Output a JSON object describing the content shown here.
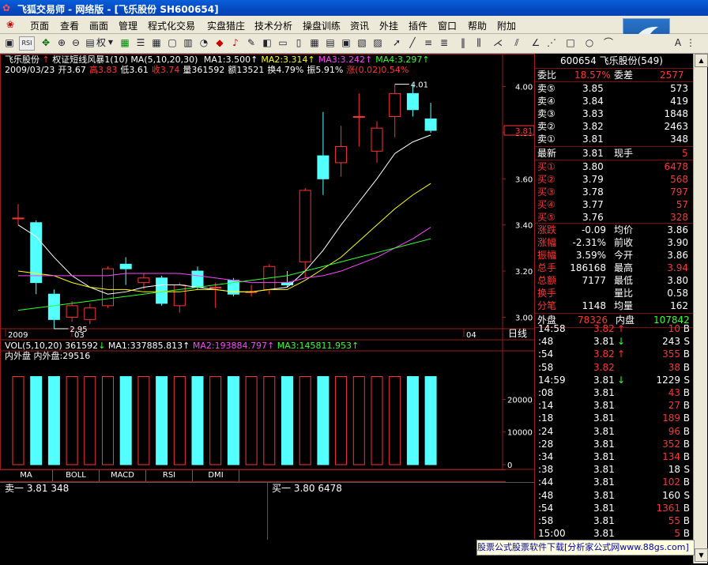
{
  "window": {
    "title": "飞狐交易师 - 网络版 - [飞乐股份 SH600654]"
  },
  "menu": [
    "页面",
    "查看",
    "画面",
    "管理",
    "程式化交易",
    "实盘猎庄",
    "技术分析",
    "操盘训练",
    "资讯",
    "外挂",
    "插件",
    "窗口",
    "帮助",
    "附加"
  ],
  "chart": {
    "stock_name": "飞乐股份",
    "indicator": "权证短线风暴1(10)",
    "ma_params": "MA(5,10,20,30)",
    "ma_items": [
      {
        "label": "MA1:3.500",
        "color": "#ffffff"
      },
      {
        "label": "MA2:3.314",
        "color": "#ffff00"
      },
      {
        "label": "MA3:3.242",
        "color": "#ff44ff"
      },
      {
        "label": "MA4:3.297",
        "color": "#33ff33"
      }
    ],
    "info": [
      {
        "label": "2009/03/23",
        "color": "#ffffff"
      },
      {
        "label": "开3.67",
        "color": "#ffffff"
      },
      {
        "label": "高3.83",
        "color": "#ff3333"
      },
      {
        "label": "低3.61",
        "color": "#ffffff"
      },
      {
        "label": "收3.74",
        "color": "#ff3333"
      },
      {
        "label": "量361592",
        "color": "#ffffff"
      },
      {
        "label": "额13521",
        "color": "#ffffff"
      },
      {
        "label": "换4.79%",
        "color": "#ffffff"
      },
      {
        "label": "振5.91%",
        "color": "#ffffff"
      },
      {
        "label": "涨(0.02)0.54%",
        "color": "#ff3333"
      }
    ],
    "high_label": "4.01",
    "low_label": "2.95",
    "price_axis": [
      "4.00",
      "3.80",
      "3.60",
      "3.40",
      "3.20",
      "3.00"
    ],
    "current_price_tag": "3.81",
    "date_axis": [
      "2009",
      "03",
      "04"
    ],
    "period_label": "日线",
    "vol_header": {
      "text": "VOL(5,10,20) 361592",
      "ma1": "MA1:337885.813",
      "ma2": "MA2:193884.797",
      "ma3": "MA3:145811.953"
    },
    "vol_sub": "内外盘 内外盘:29516",
    "vol_axis": [
      "20000",
      "10000",
      "0"
    ],
    "candles": [
      {
        "o": 3.43,
        "c": 3.43,
        "h": 3.49,
        "l": 3.4
      },
      {
        "o": 3.41,
        "c": 3.15,
        "h": 3.42,
        "l": 3.1
      },
      {
        "o": 3.1,
        "c": 2.99,
        "h": 3.12,
        "l": 2.95
      },
      {
        "o": 3.0,
        "c": 3.05,
        "h": 3.07,
        "l": 2.98
      },
      {
        "o": 2.99,
        "c": 3.04,
        "h": 3.06,
        "l": 2.97
      },
      {
        "o": 3.05,
        "c": 3.21,
        "h": 3.22,
        "l": 3.04
      },
      {
        "o": 3.23,
        "c": 3.21,
        "h": 3.26,
        "l": 3.14
      },
      {
        "o": 3.15,
        "c": 3.17,
        "h": 3.19,
        "l": 3.12
      },
      {
        "o": 3.17,
        "c": 3.06,
        "h": 3.18,
        "l": 3.05
      },
      {
        "o": 3.05,
        "c": 3.14,
        "h": 3.15,
        "l": 3.02
      },
      {
        "o": 3.2,
        "c": 3.13,
        "h": 3.22,
        "l": 3.12
      },
      {
        "o": 3.13,
        "c": 3.13,
        "h": 3.15,
        "l": 3.04
      },
      {
        "o": 3.16,
        "c": 3.1,
        "h": 3.17,
        "l": 3.09
      },
      {
        "o": 3.11,
        "c": 3.11,
        "h": 3.14,
        "l": 3.09
      },
      {
        "o": 3.12,
        "c": 3.22,
        "h": 3.23,
        "l": 3.1
      },
      {
        "o": 3.15,
        "c": 3.14,
        "h": 3.2,
        "l": 3.13
      },
      {
        "o": 3.24,
        "c": 3.55,
        "h": 3.56,
        "l": 3.17
      },
      {
        "o": 3.7,
        "c": 3.6,
        "h": 3.89,
        "l": 3.53
      },
      {
        "o": 3.67,
        "c": 3.74,
        "h": 3.83,
        "l": 3.61
      },
      {
        "o": 3.87,
        "c": 3.87,
        "h": 3.97,
        "l": 3.74
      },
      {
        "o": 3.72,
        "c": 3.82,
        "h": 3.85,
        "l": 3.67
      },
      {
        "o": 3.87,
        "c": 3.97,
        "h": 4.01,
        "l": 3.78
      },
      {
        "o": 3.97,
        "c": 3.9,
        "h": 4.01,
        "l": 3.87
      },
      {
        "o": 3.86,
        "c": 3.81,
        "h": 3.93,
        "l": 3.8
      }
    ],
    "ma_lines": {
      "ma1": [
        3.4,
        3.35,
        3.26,
        3.18,
        3.13,
        3.1,
        3.11,
        3.13,
        3.14,
        3.14,
        3.13,
        3.12,
        3.11,
        3.11,
        3.12,
        3.13,
        3.2,
        3.29,
        3.4,
        3.5,
        3.6,
        3.71,
        3.76,
        3.79
      ],
      "ma2": [
        3.2,
        3.19,
        3.18,
        3.15,
        3.13,
        3.12,
        3.12,
        3.11,
        3.11,
        3.11,
        3.12,
        3.12,
        3.11,
        3.11,
        3.12,
        3.12,
        3.16,
        3.21,
        3.26,
        3.33,
        3.4,
        3.47,
        3.53,
        3.58
      ],
      "ma3": [
        3.18,
        3.18,
        3.18,
        3.18,
        3.18,
        3.18,
        3.19,
        3.19,
        3.19,
        3.19,
        3.18,
        3.17,
        3.16,
        3.15,
        3.15,
        3.15,
        3.17,
        3.18,
        3.2,
        3.23,
        3.26,
        3.3,
        3.34,
        3.39
      ],
      "ma4": [
        3.03,
        3.04,
        3.05,
        3.06,
        3.07,
        3.08,
        3.09,
        3.1,
        3.11,
        3.12,
        3.13,
        3.14,
        3.15,
        3.16,
        3.17,
        3.18,
        3.2,
        3.22,
        3.24,
        3.26,
        3.28,
        3.3,
        3.32,
        3.34
      ]
    },
    "volumes": [
      27000,
      27000,
      27000,
      27000,
      27000,
      27000,
      27000,
      27000,
      27000,
      27000,
      27000,
      27000,
      27000,
      27000,
      27000,
      27000,
      27000,
      27000,
      27000,
      27000,
      27000,
      27000,
      27000,
      27000
    ]
  },
  "bottom_tabs": [
    "MA",
    "BOLL",
    "MACD",
    "RSI",
    "DMI"
  ],
  "bottom_status": {
    "sell1_label": "卖一",
    "sell1_price": "3.81",
    "sell1_vol": "348",
    "buy1_label": "买一",
    "buy1_price": "3.80",
    "buy1_vol": "6478"
  },
  "quote": {
    "header": "600654 飞乐股份(549)",
    "weibi_label": "委比",
    "weibi": "18.57%",
    "weicha_label": "委差",
    "weicha": "2577",
    "sells": [
      {
        "label": "卖⑤",
        "price": "3.85",
        "vol": "573"
      },
      {
        "label": "卖④",
        "price": "3.84",
        "vol": "419"
      },
      {
        "label": "卖③",
        "price": "3.83",
        "vol": "1848"
      },
      {
        "label": "卖②",
        "price": "3.82",
        "vol": "2463"
      },
      {
        "label": "卖①",
        "price": "3.81",
        "vol": "348"
      }
    ],
    "latest_label": "最新",
    "latest": "3.81",
    "xianshou_label": "现手",
    "xianshou": "5",
    "buys": [
      {
        "label": "买①",
        "price": "3.80",
        "vol": "6478"
      },
      {
        "label": "买②",
        "price": "3.79",
        "vol": "568"
      },
      {
        "label": "买③",
        "price": "3.78",
        "vol": "797"
      },
      {
        "label": "买④",
        "price": "3.77",
        "vol": "57"
      },
      {
        "label": "买⑤",
        "price": "3.76",
        "vol": "328"
      }
    ],
    "stats": [
      {
        "l1": "涨跌",
        "v1": "-0.09",
        "l2": "均价",
        "v2": "3.86",
        "c2": "#fff"
      },
      {
        "l1": "涨幅",
        "v1": "-2.31%",
        "l2": "前收",
        "v2": "3.90",
        "c2": "#fff"
      },
      {
        "l1": "振幅",
        "v1": "3.59%",
        "l2": "今开",
        "v2": "3.86",
        "c2": "#fff"
      },
      {
        "l1": "总手",
        "v1": "186168",
        "l2": "最高",
        "v2": "3.94",
        "c2": "#ff3333"
      },
      {
        "l1": "总额",
        "v1": "7177",
        "l2": "最低",
        "v2": "3.80",
        "c2": "#fff"
      },
      {
        "l1": "换手",
        "v1": "",
        "l2": "量比",
        "v2": "0.58",
        "c2": "#fff"
      },
      {
        "l1": "分笔",
        "v1": "1148",
        "l2": "均量",
        "v2": "162",
        "c2": "#fff"
      }
    ],
    "waipan_label": "外盘",
    "waipan": "78326",
    "neipan_label": "内盘",
    "neipan": "107842",
    "ticks": [
      {
        "t": "14:58",
        "p": "3.82",
        "a": "↑",
        "v": "10",
        "s": "B",
        "pc": "#ff3333",
        "vc": "#ff3333"
      },
      {
        "t": ":48",
        "p": "3.81",
        "a": "↓",
        "v": "243",
        "s": "S",
        "pc": "#fff",
        "vc": "#fff"
      },
      {
        "t": ":54",
        "p": "3.82",
        "a": "↑",
        "v": "355",
        "s": "B",
        "pc": "#ff3333",
        "vc": "#ff3333"
      },
      {
        "t": ":58",
        "p": "3.82",
        "a": "",
        "v": "38",
        "s": "B",
        "pc": "#ff3333",
        "vc": "#ff3333"
      },
      {
        "t": "14:59",
        "p": "3.81",
        "a": "↓",
        "v": "1229",
        "s": "S",
        "pc": "#fff",
        "vc": "#fff"
      },
      {
        "t": ":08",
        "p": "3.81",
        "a": "",
        "v": "43",
        "s": "B",
        "pc": "#fff",
        "vc": "#ff3333"
      },
      {
        "t": ":14",
        "p": "3.81",
        "a": "",
        "v": "27",
        "s": "B",
        "pc": "#fff",
        "vc": "#ff3333"
      },
      {
        "t": ":18",
        "p": "3.81",
        "a": "",
        "v": "189",
        "s": "B",
        "pc": "#fff",
        "vc": "#ff3333"
      },
      {
        "t": ":24",
        "p": "3.81",
        "a": "",
        "v": "96",
        "s": "B",
        "pc": "#fff",
        "vc": "#ff3333"
      },
      {
        "t": ":28",
        "p": "3.81",
        "a": "",
        "v": "352",
        "s": "B",
        "pc": "#fff",
        "vc": "#ff3333"
      },
      {
        "t": ":34",
        "p": "3.81",
        "a": "",
        "v": "134",
        "s": "B",
        "pc": "#fff",
        "vc": "#ff3333"
      },
      {
        "t": ":38",
        "p": "3.81",
        "a": "",
        "v": "18",
        "s": "S",
        "pc": "#fff",
        "vc": "#fff"
      },
      {
        "t": ":44",
        "p": "3.81",
        "a": "",
        "v": "102",
        "s": "B",
        "pc": "#fff",
        "vc": "#ff3333"
      },
      {
        "t": ":48",
        "p": "3.81",
        "a": "",
        "v": "160",
        "s": "S",
        "pc": "#fff",
        "vc": "#fff"
      },
      {
        "t": ":54",
        "p": "3.81",
        "a": "",
        "v": "1361",
        "s": "B",
        "pc": "#fff",
        "vc": "#ff3333"
      },
      {
        "t": ":58",
        "p": "3.81",
        "a": "",
        "v": "55",
        "s": "B",
        "pc": "#fff",
        "vc": "#ff3333"
      },
      {
        "t": "15:00",
        "p": "3.81",
        "a": "",
        "v": "5",
        "s": "B",
        "pc": "#fff",
        "vc": "#ff3333"
      }
    ]
  },
  "footer_ad": "股票公式股票软件下载[分析家公式网www.88gs.com]",
  "toolbar_labels": {
    "rsi": "RSI",
    "quan": "权"
  },
  "colors": {
    "up": "#ff3333",
    "down": "#54ffff",
    "axis": "#9a1c1c",
    "ma1": "#ffffff",
    "ma2": "#ffff00",
    "ma3": "#ff44ff",
    "ma4": "#33ff33"
  }
}
